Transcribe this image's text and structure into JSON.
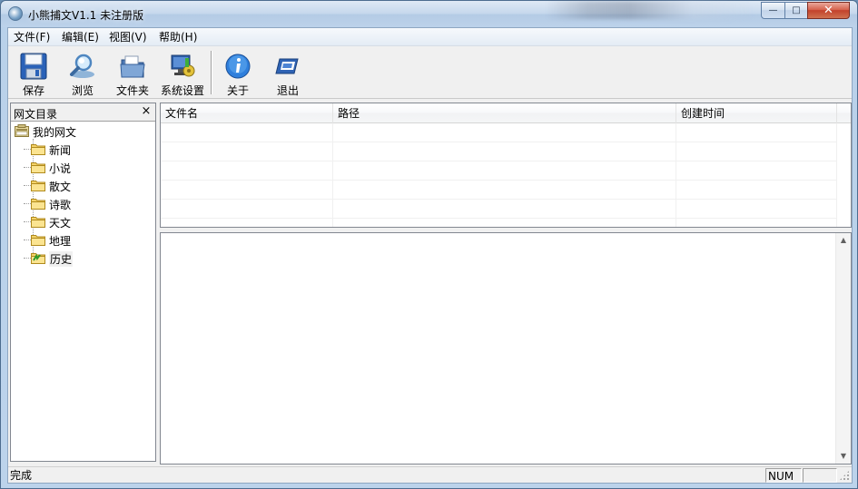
{
  "window": {
    "title": "小熊捕文V1.1 未注册版",
    "buttons": {
      "minimize": "—",
      "maximize": "□",
      "close": "✕"
    }
  },
  "menubar": {
    "items": [
      {
        "label": "文件(F)"
      },
      {
        "label": "编辑(E)"
      },
      {
        "label": "视图(V)"
      },
      {
        "label": "帮助(H)"
      }
    ]
  },
  "toolbar": {
    "buttons": [
      {
        "label": "保存",
        "icon": "floppy-disk-icon"
      },
      {
        "label": "浏览",
        "icon": "magnifier-icon"
      },
      {
        "label": "文件夹",
        "icon": "folder-icon"
      },
      {
        "label": "系统设置",
        "icon": "settings-icon"
      },
      {
        "label": "关于",
        "icon": "info-icon"
      },
      {
        "label": "退出",
        "icon": "exit-icon"
      }
    ]
  },
  "left_panel": {
    "title": "网文目录",
    "close": "×",
    "tree": {
      "root": {
        "label": "我的网文",
        "icon": "root-folder-icon"
      },
      "children": [
        {
          "label": "新闻",
          "icon": "folder-icon"
        },
        {
          "label": "小说",
          "icon": "folder-icon"
        },
        {
          "label": "散文",
          "icon": "folder-icon"
        },
        {
          "label": "诗歌",
          "icon": "folder-icon"
        },
        {
          "label": "天文",
          "icon": "folder-icon"
        },
        {
          "label": "地理",
          "icon": "folder-icon"
        },
        {
          "label": "历史",
          "icon": "history-icon"
        }
      ]
    }
  },
  "list": {
    "columns": [
      "文件名",
      "路径",
      "创建时间"
    ],
    "rows": []
  },
  "statusbar": {
    "status": "完成",
    "num": "NUM"
  },
  "colors": {
    "frame": "#b9d1ea",
    "close_button": "#c2412b",
    "panel_border": "#828790",
    "background": "#f0f0f0"
  }
}
